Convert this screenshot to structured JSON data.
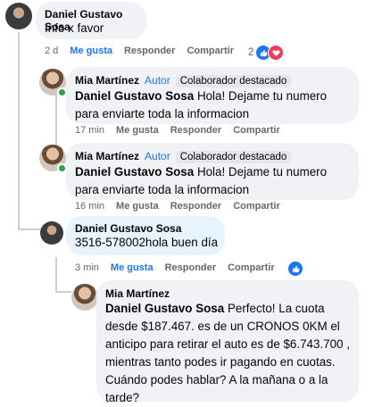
{
  "comments": [
    {
      "author": "Daniel Gustavo Sosa",
      "text": "Info x favor",
      "time": "2 d",
      "like": "Me gusta",
      "reply": "Responder",
      "share": "Compartir",
      "reaction_count": "2"
    },
    {
      "author": "Mia Martínez",
      "role": "Autor",
      "badge": "Colaborador destacado",
      "mention": "Daniel Gustavo Sosa",
      "text": " Hola! Dejame tu numero para enviarte toda la informacion",
      "time": "17 min",
      "like": "Me gusta",
      "reply": "Responder",
      "share": "Compartir"
    },
    {
      "author": "Mia Martínez",
      "role": "Autor",
      "badge": "Colaborador destacado",
      "mention": "Daniel Gustavo Sosa",
      "text": " Hola! Dejame tu numero para enviarte toda la informacion",
      "time": "16 min",
      "like": "Me gusta",
      "reply": "Responder",
      "share": "Compartir"
    },
    {
      "author": "Daniel Gustavo Sosa",
      "text": "3516-578002hola buen día",
      "time": "3 min",
      "like": "Me gusta",
      "reply": "Responder",
      "share": "Compartir"
    },
    {
      "author": "Mia Martínez",
      "mention": "Daniel Gustavo Sosa",
      "text": " Perfecto! La cuota desde $187.467. es de un CRONOS 0KM el anticipo para retirar el auto es de $6.743.700 , mientras tanto podes ir pagando en cuotas. Cuándo podes hablar? A la mañana o a la tarde?"
    }
  ],
  "colors": {
    "accent": "#1877f2",
    "bubble": "#f0f2f5",
    "bubble_highlight": "#e7f3ff",
    "love": "#f33e58",
    "online": "#31a24c"
  },
  "icons": [
    "like-icon",
    "love-icon",
    "online-dot"
  ]
}
